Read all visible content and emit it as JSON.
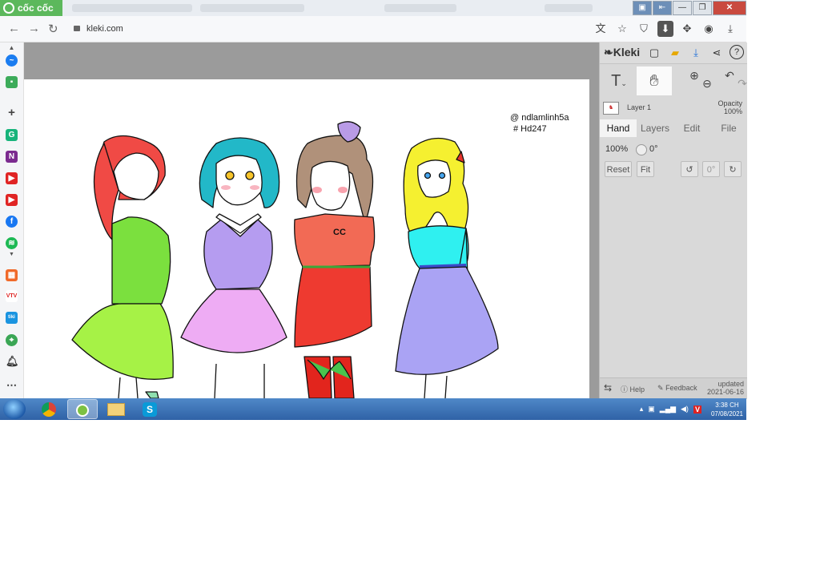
{
  "browser": {
    "brand": "cốc cốc",
    "url": "kleki.com"
  },
  "window": {
    "minimize": "—",
    "restore": "❐",
    "close": "✕"
  },
  "sidebar": {
    "items": [
      "messenger-icon",
      "games-icon",
      "add-icon",
      "grammarly-icon",
      "onenote-icon",
      "youtube-icon",
      "youtube-music-icon",
      "facebook-icon",
      "spotify-icon",
      "shop-icon",
      "vtv-icon",
      "tiki-icon",
      "maps-icon",
      "notifications-icon",
      "more-icon"
    ]
  },
  "canvas": {
    "watermark_line1": "@ ndlamlinh5a",
    "watermark_line2": "# Hd247",
    "shirt_logo": "CC"
  },
  "kleki": {
    "title": "Kleki",
    "layer_name": "Layer 1",
    "opacity_label": "Opacity",
    "opacity_value": "100%",
    "tabs": [
      "Hand",
      "Layers",
      "Edit",
      "File"
    ],
    "active_tab": "Hand",
    "zoom": "100%",
    "angle": "0°",
    "reset_label": "Reset",
    "fit_label": "Fit",
    "rotate_value": "0°",
    "help_label": "Help",
    "feedback_label": "Feedback",
    "updated_label": "updated",
    "updated_date": "2021-06-16"
  },
  "taskbar": {
    "time": "3:38 CH",
    "date": "07/08/2021"
  }
}
